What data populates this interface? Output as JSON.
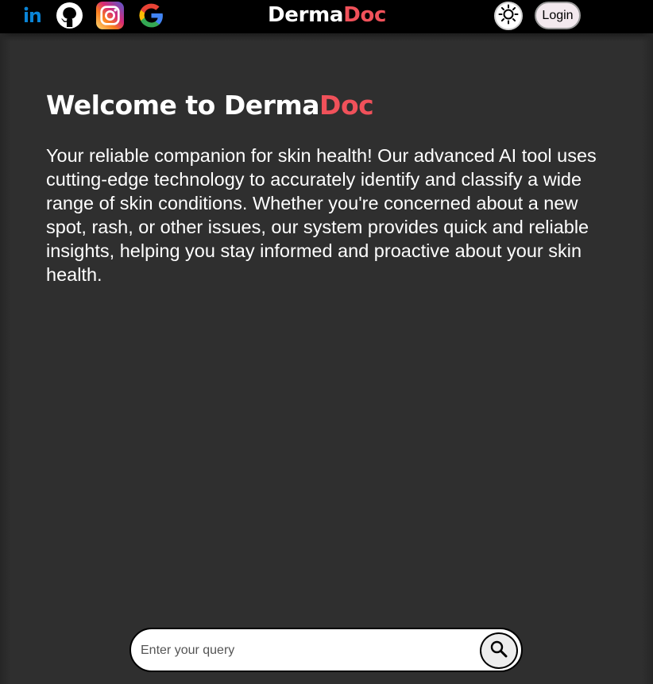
{
  "header": {
    "brand_part1": "Derma",
    "brand_part2": "Doc",
    "login_label": "Login",
    "icons": [
      "linkedin-icon",
      "github-icon",
      "instagram-icon",
      "google-icon",
      "sun-icon"
    ]
  },
  "main": {
    "title_part1": "Welcome to Derma",
    "title_part2": "Doc",
    "intro": "Your reliable companion for skin health! Our advanced AI tool uses cutting-edge technology to accurately identify and classify a wide range of skin conditions. Whether you're concerned about a new spot, rash, or other issues, our system provides quick and reliable insights, helping you stay informed and proactive about your skin health."
  },
  "search": {
    "placeholder": "Enter your query",
    "value": "",
    "icon": "search-icon"
  },
  "colors": {
    "accent": "#f0515a",
    "background": "#2f2f2f",
    "topbar": "#000000"
  }
}
